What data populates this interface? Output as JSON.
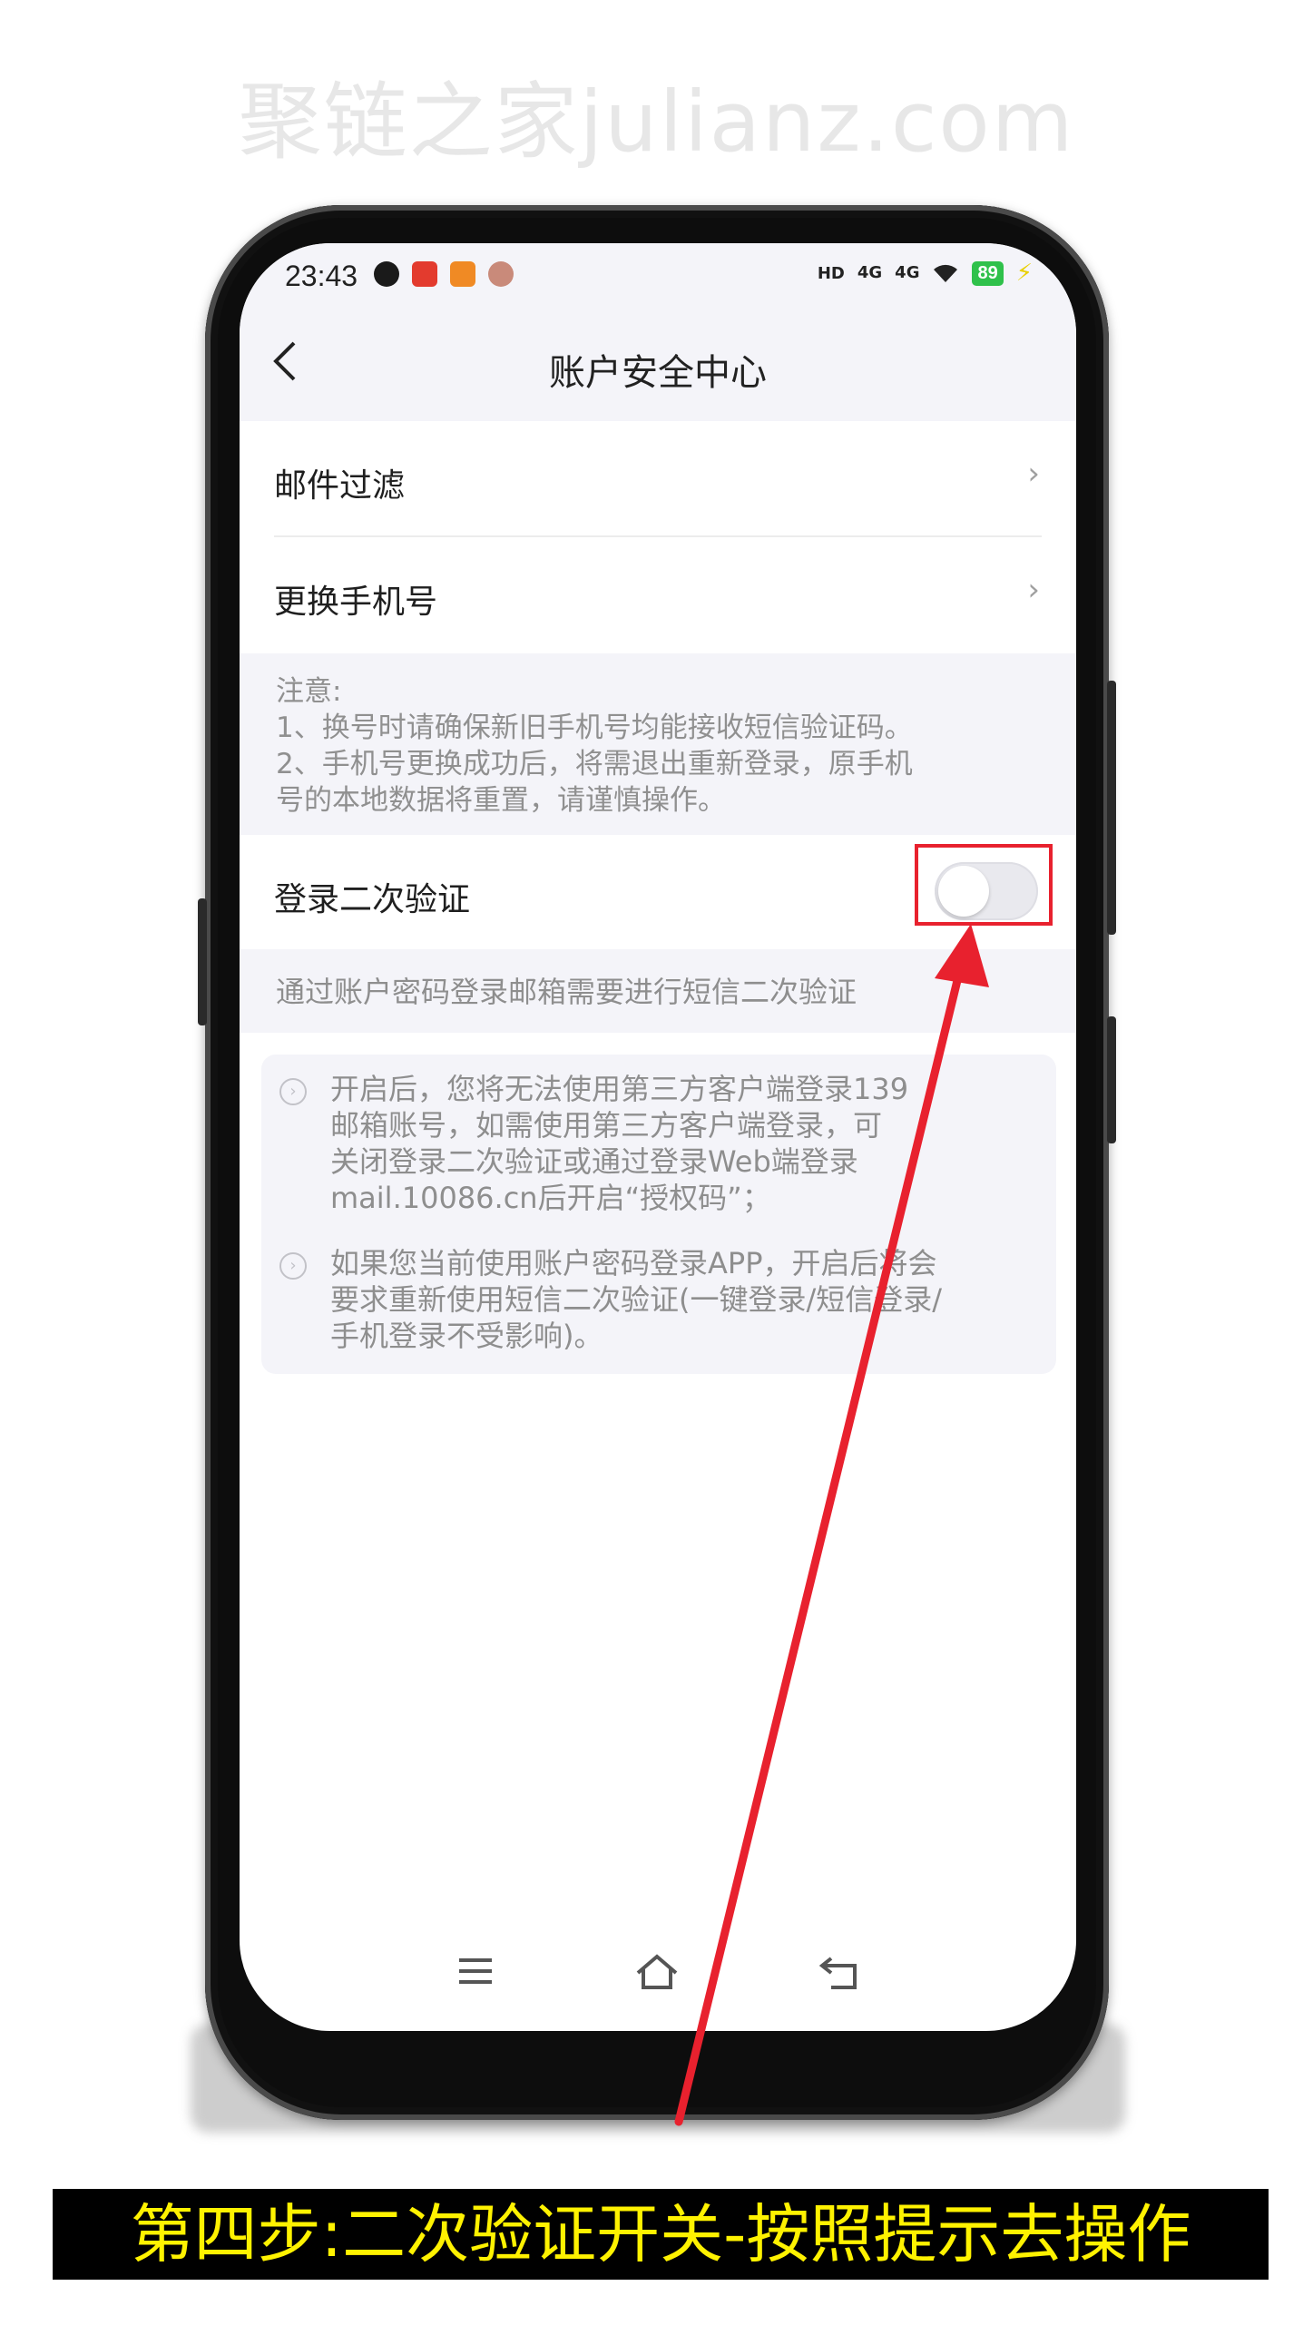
{
  "watermark": "聚链之家julianz.com",
  "status": {
    "time": "23:43",
    "hd": "HD",
    "net1": "4G",
    "net2": "4G",
    "battery": "89"
  },
  "header": {
    "title": "账户安全中心"
  },
  "menu": {
    "items": [
      {
        "label": "邮件过滤"
      },
      {
        "label": "更换手机号"
      }
    ]
  },
  "note": {
    "title": "注意:",
    "line1": "1、换号时请确保新旧手机号均能接收短信验证码。",
    "line2": "2、手机号更换成功后，将需退出重新登录，原手机",
    "line3": "号的本地数据将重置，请谨慎操作。"
  },
  "two_factor": {
    "label": "登录二次验证",
    "enabled": false,
    "description": "通过账户密码登录邮箱需要进行短信二次验证"
  },
  "tips": [
    {
      "lines": [
        "开启后，您将无法使用第三方客户端登录139",
        "邮箱账号，如需使用第三方客户端登录，可",
        "关闭登录二次验证或通过登录Web端登录",
        "mail.10086.cn后开启“授权码”；"
      ]
    },
    {
      "lines": [
        "如果您当前使用账户密码登录APP，开启后将会",
        "要求重新使用短信二次验证(一键登录/短信登录/",
        "手机登录不受影响)。"
      ]
    }
  ],
  "caption": "第四步:二次验证开关-按照提示去操作",
  "colors": {
    "annotation_red": "#e8212e",
    "caption_yellow": "#fff200",
    "battery_green": "#2fc14b"
  }
}
